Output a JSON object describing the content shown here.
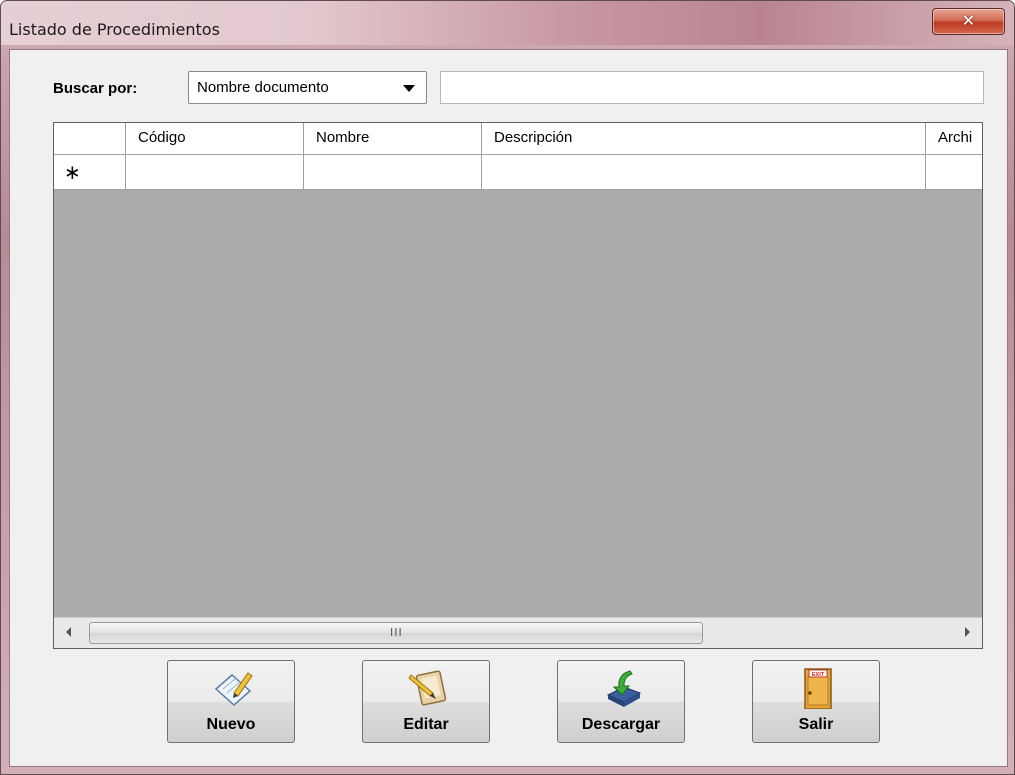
{
  "window": {
    "title": "Listado de Procedimientos"
  },
  "search": {
    "label": "Buscar por:",
    "field_value": "Nombre documento",
    "query": ""
  },
  "grid": {
    "columns": [
      "",
      "Código",
      "Nombre",
      "Descripción",
      "Archi"
    ],
    "new_row_marker": "∗",
    "scroll_grip": "III"
  },
  "buttons": {
    "nuevo": "Nuevo",
    "editar": "Editar",
    "descargar": "Descargar",
    "salir": "Salir",
    "exit_sign": "EXIT"
  },
  "colors": {
    "grid_background": "#ababab",
    "close_button": "#c9452c"
  }
}
